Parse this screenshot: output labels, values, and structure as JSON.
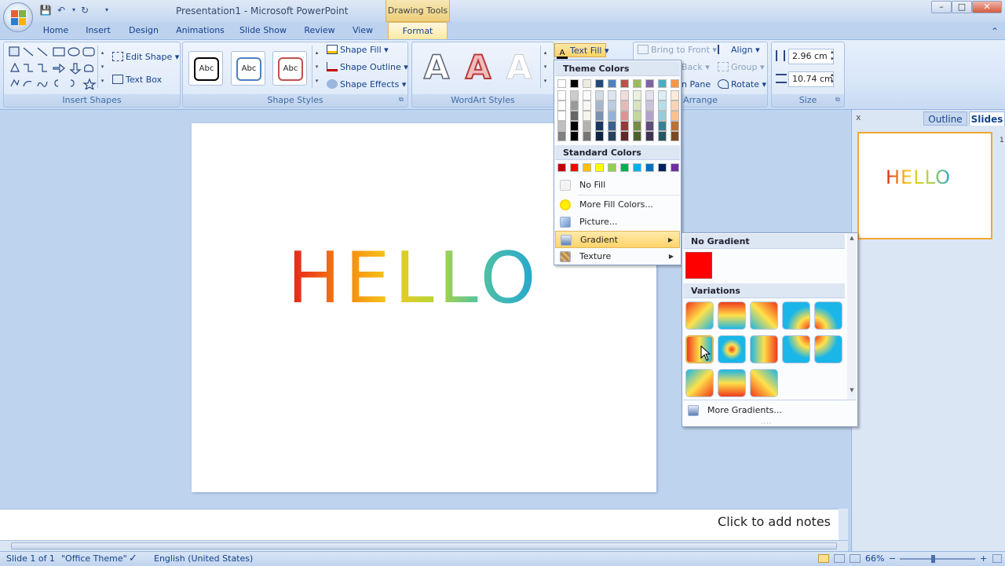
{
  "title_bar": {
    "document": "Presentation1",
    "separator": " - ",
    "app": "Microsoft PowerPoint",
    "contextual_tab_group": "Drawing Tools",
    "window_buttons": [
      "–",
      "□",
      "✕"
    ]
  },
  "tabs": [
    "Home",
    "Insert",
    "Design",
    "Animations",
    "Slide Show",
    "Review",
    "View",
    "Format"
  ],
  "ribbon": {
    "insert_shapes": {
      "label": "Insert Shapes",
      "edit_shape": "Edit Shape",
      "text_box": "Text Box"
    },
    "shape_styles": {
      "label": "Shape Styles",
      "preset_text": "Abc",
      "shape_fill": "Shape Fill",
      "shape_outline": "Shape Outline",
      "shape_effects": "Shape Effects"
    },
    "wordart_styles": {
      "label": "WordArt Styles",
      "glyph": "A",
      "text_fill": "Text Fill"
    },
    "arrange": {
      "label": "Arrange",
      "bring_to_front": "Bring to Front",
      "send_to_back": "Back",
      "selection_pane": "n Pane",
      "align": "Align",
      "group": "Group",
      "rotate": "Rotate"
    },
    "size": {
      "label": "Size",
      "height": "2.96 cm",
      "width": "10.74 cm"
    }
  },
  "slide": {
    "text": "HELLO"
  },
  "notes_placeholder": "Click to add notes",
  "right_pane": {
    "close": "x",
    "outline_tab": "Outline",
    "slides_tab": "Slides",
    "slide_number": "1",
    "thumbnail_text": "HELLO"
  },
  "text_fill_menu": {
    "theme_colors_heading": "Theme Colors",
    "standard_colors_heading": "Standard Colors",
    "items": [
      "No Fill",
      "More Fill Colors...",
      "Picture...",
      "Gradient",
      "Texture"
    ],
    "theme_colors": [
      "#ffffff",
      "#000000",
      "#eeece1",
      "#1f497d",
      "#4f81bd",
      "#c0504d",
      "#9bbb59",
      "#8064a2",
      "#4bacc6",
      "#f79646"
    ],
    "standard_colors": [
      "#c00000",
      "#ff0000",
      "#ffc000",
      "#ffff00",
      "#92d050",
      "#00b050",
      "#00b0f0",
      "#0070c0",
      "#002060",
      "#7030a0"
    ]
  },
  "gradient_menu": {
    "no_gradient_heading": "No Gradient",
    "variations_heading": "Variations",
    "more_gradients": "More Gradients...",
    "base_color": "#ff0000"
  },
  "status_bar": {
    "slide_info": "Slide 1 of 1",
    "theme": "\"Office Theme\"",
    "language": "English (United States)",
    "zoom": "66%",
    "zoom_minus": "−",
    "zoom_plus": "+"
  },
  "colors": {
    "accent_tab": "#fde9a4",
    "ribbon": "#dce8f8",
    "workspace": "#bed3ee"
  }
}
